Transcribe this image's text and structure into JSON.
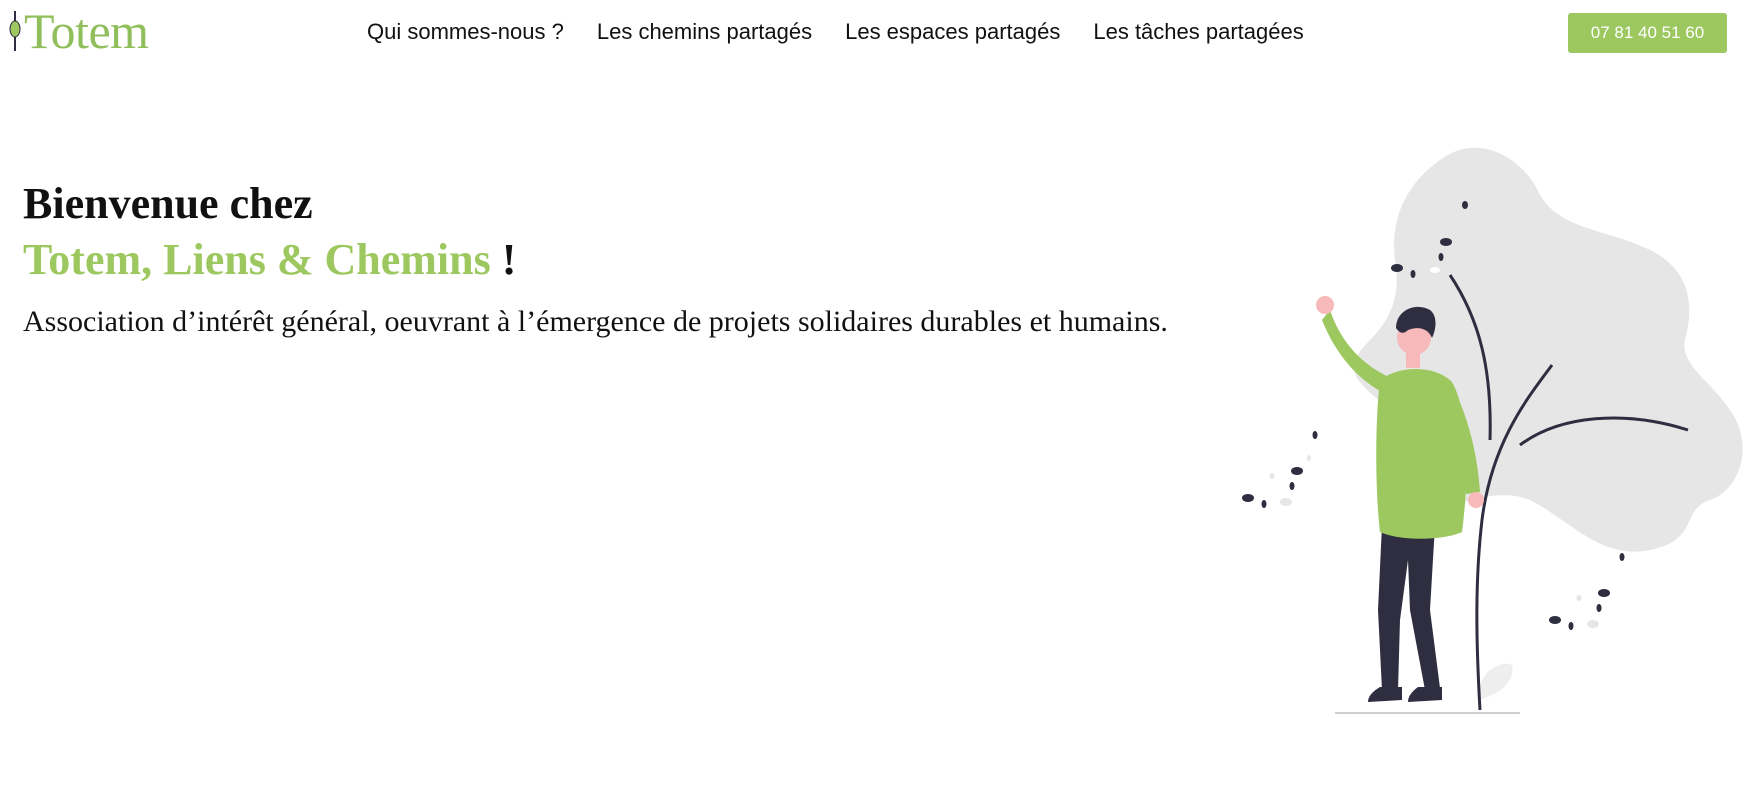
{
  "header": {
    "logo_text": "Totem",
    "nav": [
      {
        "label": "Qui sommes-nous ?"
      },
      {
        "label": "Les chemins partagés"
      },
      {
        "label": "Les espaces partagés"
      },
      {
        "label": "Les tâches partagées"
      }
    ],
    "phone": "07 81 40 51 60"
  },
  "hero": {
    "line1": "Bienvenue chez",
    "line2_accent": "Totem, Liens & Chemins",
    "line2_punct": " !",
    "subtitle": "Association d’intérêt général, oeuvrant à l’émergence de projets solidaires durables et humains."
  },
  "colors": {
    "accent": "#9cc85f",
    "text": "#111111",
    "blob": "#e6e6e6",
    "dark": "#2f2e41"
  },
  "icons": {
    "logo_mark": "totem-logo-icon",
    "illustration": "person-waving-plant-illustration"
  }
}
